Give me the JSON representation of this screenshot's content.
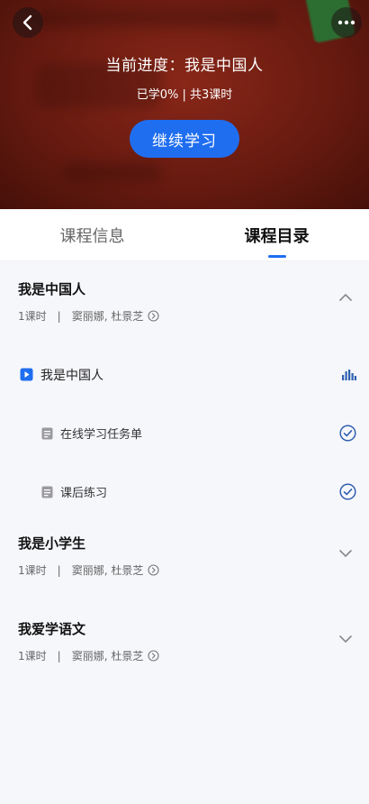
{
  "header": {
    "progress_title": "当前进度：我是中国人",
    "progress_stats": "已学0% | 共3课时",
    "continue_label": "继续学习"
  },
  "tabs": [
    {
      "label": "课程信息",
      "active": false
    },
    {
      "label": "课程目录",
      "active": true
    }
  ],
  "chapters": [
    {
      "title": "我是中国人",
      "hours": "1课时",
      "separator": "|",
      "teachers": "窦丽娜, 杜景芝",
      "expanded": true,
      "lessons": [
        {
          "label": "我是中国人",
          "status_icon": "audio-bars-icon"
        }
      ],
      "tasks": [
        {
          "label": "在线学习任务单",
          "done": true
        },
        {
          "label": "课后练习",
          "done": true
        }
      ]
    },
    {
      "title": "我是小学生",
      "hours": "1课时",
      "separator": "|",
      "teachers": "窦丽娜, 杜景芝",
      "expanded": false
    },
    {
      "title": "我爱学语文",
      "hours": "1课时",
      "separator": "|",
      "teachers": "窦丽娜, 杜景芝",
      "expanded": false
    }
  ],
  "colors": {
    "accent": "#1f6ef0",
    "hero_red": "#8a2616",
    "check_blue": "#2f5fb0"
  }
}
